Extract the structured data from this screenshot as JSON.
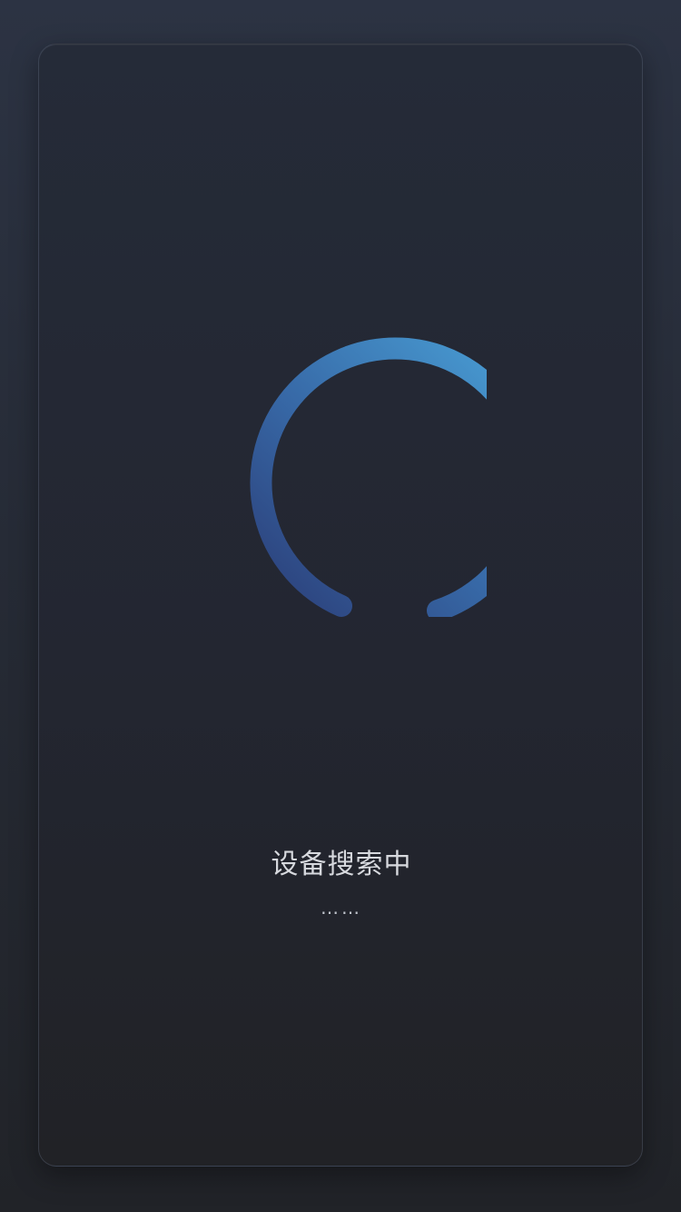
{
  "screen": {
    "status_text": "设备搜索中",
    "status_dots": "……",
    "spinner": {
      "icon": "loading-spinner-icon",
      "start_color": "#2b3d77",
      "end_color": "#4aa1d7"
    }
  }
}
